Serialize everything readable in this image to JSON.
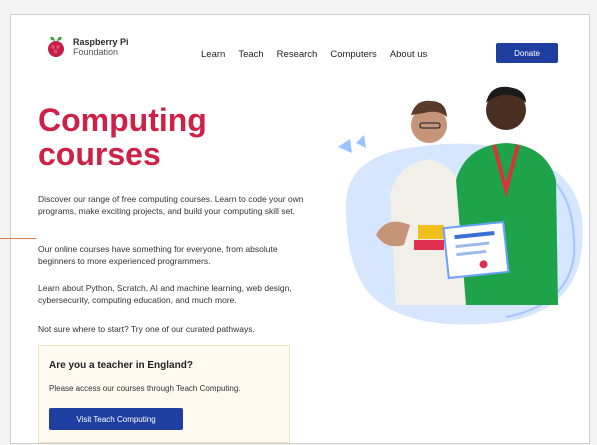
{
  "header": {
    "logo": {
      "line1": "Raspberry Pi",
      "line2": "Foundation",
      "icon": "raspberry-icon"
    },
    "nav": [
      "Learn",
      "Teach",
      "Research",
      "Computers",
      "About us"
    ],
    "donate_label": "Donate"
  },
  "hero": {
    "title_line1": "Computing",
    "title_line2": "courses",
    "paragraphs": [
      "Discover our range of free computing courses. Learn to code your own programs, make exciting projects, and build your computing skill set.",
      "Our online courses have something for everyone, from absolute beginners to more experienced programmers.",
      "Learn about Python, Scratch, AI and machine learning, web design, cybersecurity, computing education, and much more.",
      "Not sure where to start? Try one of our curated pathways."
    ]
  },
  "teacher_box": {
    "title": "Are you a teacher in England?",
    "text": "Please access our courses through Teach Computing.",
    "button_label": "Visit Teach Computing"
  },
  "colors": {
    "accent": "#cd2147",
    "button": "#1f3fa0",
    "blob": "#d6e6ff"
  }
}
